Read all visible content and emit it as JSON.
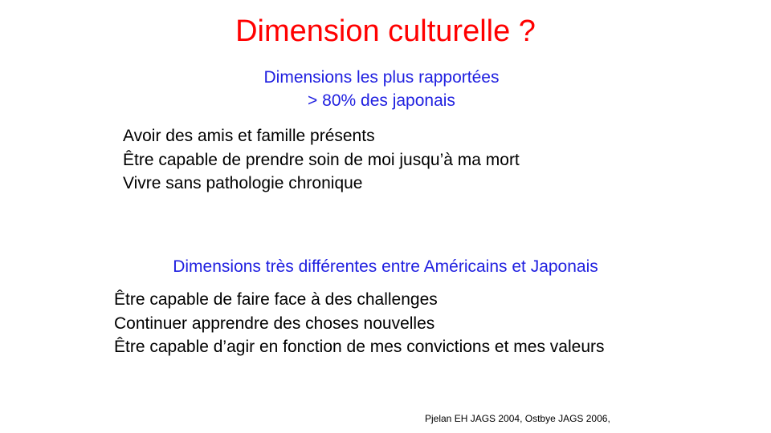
{
  "slide": {
    "title": "Dimension  culturelle ?",
    "section1": {
      "heading_line1": "Dimensions les plus rapportées",
      "heading_line2": "> 80% des japonais",
      "items": [
        "Avoir des amis et famille présents",
        "Être capable de prendre soin de moi jusqu’à ma mort",
        "Vivre sans pathologie chronique"
      ]
    },
    "section2": {
      "heading": "Dimensions très différentes entre Américains et Japonais",
      "items": [
        "Être capable de faire face à des challenges",
        "Continuer apprendre des choses nouvelles",
        "Être capable d’agir en fonction de mes convictions et mes valeurs"
      ]
    },
    "reference": "Pjelan EH JAGS  2004,  Ostbye JAGS 2006,"
  },
  "colors": {
    "title": "#ff0000",
    "subheading": "#1f1fe0",
    "body_text": "#000000",
    "background": "#ffffff"
  }
}
